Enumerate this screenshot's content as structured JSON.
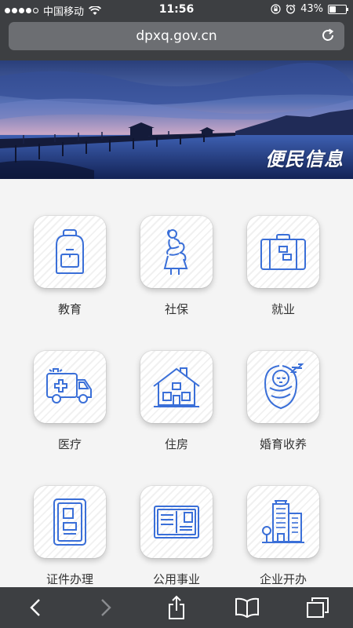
{
  "status_bar": {
    "carrier": "中国移动",
    "time": "11:56",
    "battery": "43%",
    "battery_level": 0.43
  },
  "browser": {
    "url": "dpxq.gov.cn"
  },
  "banner": {
    "title": "便民信息"
  },
  "services": [
    {
      "label": "教育",
      "icon": "backpack-icon"
    },
    {
      "label": "社保",
      "icon": "pregnant-woman-icon"
    },
    {
      "label": "就业",
      "icon": "briefcase-icon"
    },
    {
      "label": "医疗",
      "icon": "ambulance-icon"
    },
    {
      "label": "住房",
      "icon": "house-icon"
    },
    {
      "label": "婚育收养",
      "icon": "sleeping-baby-icon"
    },
    {
      "label": "证件办理",
      "icon": "id-card-icon"
    },
    {
      "label": "公用事业",
      "icon": "postcard-icon"
    },
    {
      "label": "企业开办",
      "icon": "office-building-icon"
    }
  ],
  "colors": {
    "icon_blue": "#3a6fd8",
    "chrome": "#3d3f42",
    "url_bar": "#6c6e72"
  }
}
